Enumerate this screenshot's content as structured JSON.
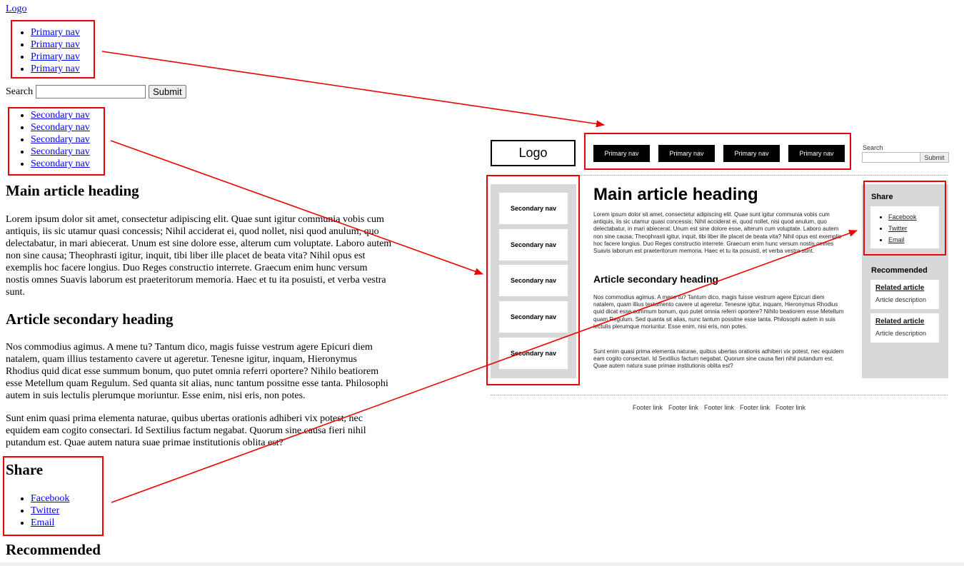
{
  "unstyled": {
    "logo": "Logo",
    "primary_nav": [
      "Primary nav",
      "Primary nav",
      "Primary nav",
      "Primary nav"
    ],
    "search_label": "Search",
    "search_button": "Submit",
    "secondary_nav": [
      "Secondary nav",
      "Secondary nav",
      "Secondary nav",
      "Secondary nav",
      "Secondary nav"
    ],
    "main_heading": "Main article heading",
    "paragraph1": "Lorem ipsum dolor sit amet, consectetur adipiscing elit. Quae sunt igitur communia vobis cum antiquis, iis sic utamur quasi concessis; Nihil acciderat ei, quod nollet, nisi quod anulum, quo delectabatur, in mari abiecerat. Unum est sine dolore esse, alterum cum voluptate. Laboro autem non sine causa; Theophrasti igitur, inquit, tibi liber ille placet de beata vita? Nihil opus est exemplis hoc facere longius. Duo Reges constructio interrete. Graecum enim hunc versum nostis omnes Suavis laborum est praeteritorum memoria. Haec et tu ita posuisti, et verba vestra sunt.",
    "secondary_heading": "Article secondary heading",
    "paragraph2": "Nos commodius agimus. A mene tu? Tantum dico, magis fuisse vestrum agere Epicuri diem natalem, quam illius testamento cavere ut ageretur. Tenesne igitur, inquam, Hieronymus Rhodius quid dicat esse summum bonum, quo putet omnia referri oportere? Nihilo beatiorem esse Metellum quam Regulum. Sed quanta sit alias, nunc tantum possitne esse tanta. Philosophi autem in suis lectulis plerumque moriuntur. Esse enim, nisi eris, non potes.",
    "paragraph3": "Sunt enim quasi prima elementa naturae, quibus ubertas orationis adhiberi vix potest, nec equidem eam cogito consectari. Id Sextilius factum negabat. Quorum sine causa fieri nihil putandum est. Quae autem natura suae primae institutionis oblita est?",
    "share_heading": "Share",
    "share_links": [
      "Facebook",
      "Twitter",
      "Email"
    ],
    "recommended_heading": "Recommended"
  },
  "wireframe": {
    "logo": "Logo",
    "primary_nav": [
      "Primary nav",
      "Primary nav",
      "Primary nav",
      "Primary nav"
    ],
    "search_label": "Search",
    "search_button": "Submit",
    "secondary_nav": [
      "Secondary nav",
      "Secondary nav",
      "Secondary nav",
      "Secondary nav",
      "Secondary nav"
    ],
    "main_heading": "Main article heading",
    "paragraph1": "Lorem ipsum dolor sit amet, consectetur adipiscing elit. Quae sunt igitur communia vobis cum antiquis, iis sic utamur quasi concessis; Nihil acciderat ei, quod nollet, nisi quod anulum, quo delectabatur, in mari abiecerat. Unum est sine dolore esse, alterum cum voluptate. Laboro autem non sine causa; Theophrasti igitur, inquit, tibi liber ille placet de beata vita? Nihil opus est exemplis hoc facere longius. Duo Reges constructio interrete. Graecum enim hunc versum nostis omnes Suavis laborum est praeteritorum memoria. Haec et tu ita posuisti, et verba vestra sunt.",
    "secondary_heading": "Article secondary heading",
    "paragraph2": "Nos commodius agimus. A mene tu? Tantum dico, magis fuisse vestrum agere Epicuri diem natalem, quam illius testamento cavere ut ageretur. Tenesne igitur, inquam, Hieronymus Rhodius quid dicat esse summum bonum, quo putet omnia referri oportere? Nihilo beatiorem esse Metellum quam Regulum. Sed quanta sit alias, nunc tantum possitne esse tanta. Philosophi autem in suis lectulis plerumque moriuntur. Esse enim, nisi eris, non potes.",
    "paragraph3": "Sunt enim quasi prima elementa naturae, quibus ubertas orationis adhiberi vix potest, nec equidem eam cogito consectari. Id Sextilius factum negabat. Quorum sine causa fieri nihil putandum est. Quae autem natura suae primae institutionis oblita est?",
    "share_heading": "Share",
    "share_links": [
      "Facebook",
      "Twitter",
      "Email"
    ],
    "recommended_heading": "Recommended",
    "related": [
      {
        "title": "Related article",
        "description": "Article description"
      },
      {
        "title": "Related article",
        "description": "Article description"
      }
    ],
    "footer_links": [
      "Footer link",
      "Footer link",
      "Footer link",
      "Footer link",
      "Footer link"
    ]
  },
  "colors": {
    "highlight": "#ee0000",
    "sidebar_bg": "#d8d8d8",
    "nav_bg": "#000000"
  }
}
